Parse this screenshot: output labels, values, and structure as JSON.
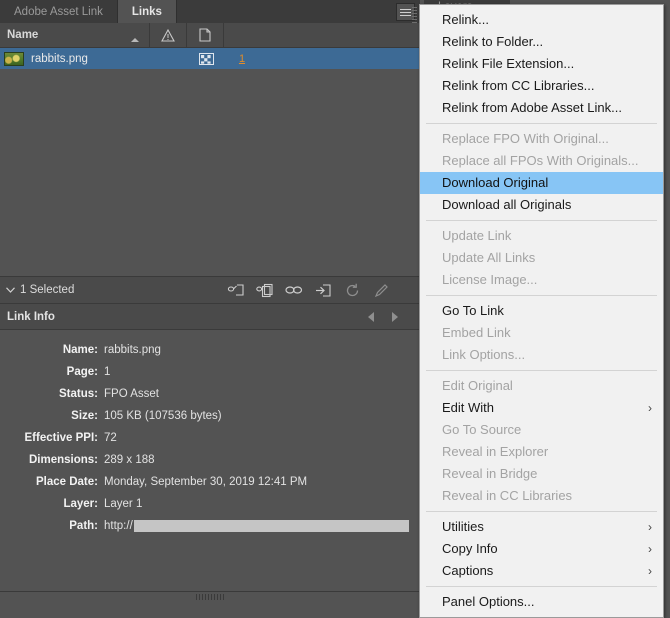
{
  "panel": {
    "tabs": [
      {
        "label": "Adobe Asset Link",
        "active": false
      },
      {
        "label": "Links",
        "active": true
      }
    ],
    "panel_menu_icon": "hamburger-menu-icon",
    "columns": {
      "name": "Name",
      "sort_icon": "sort-ascending-icon",
      "status_icon": "warning-triangle-icon",
      "page_icon": "page-icon"
    },
    "rows": [
      {
        "thumbnail": "image-thumbnail",
        "name": "rabbits.png",
        "status_icon": "fpo-asset-icon",
        "page": "1"
      }
    ],
    "selection_bar": {
      "disclosure_icon": "chevron-down-icon",
      "label": "1 Selected",
      "tools": [
        "relink-icon",
        "relink-from-library-icon",
        "go-to-link-icon",
        "update-link-icon",
        "refresh-icon",
        "edit-original-icon"
      ]
    },
    "link_info": {
      "title": "Link Info",
      "prev_icon": "previous-arrow-icon",
      "next_icon": "next-arrow-icon",
      "fields": [
        {
          "label": "Name:",
          "value": "rabbits.png"
        },
        {
          "label": "Page:",
          "value": "1"
        },
        {
          "label": "Status:",
          "value": "FPO Asset"
        },
        {
          "label": "Size:",
          "value": "105 KB (107536 bytes)"
        },
        {
          "label": "Effective PPI:",
          "value": "72"
        },
        {
          "label": "Dimensions:",
          "value": "289 x 188"
        },
        {
          "label": "Place Date:",
          "value": "Monday, September 30, 2019  12:41 PM"
        },
        {
          "label": "Layer:",
          "value": "Layer 1"
        },
        {
          "label": "Path:",
          "value": "http://"
        }
      ]
    },
    "resize_grip_icon": "resize-grip-icon"
  },
  "background_tab": {
    "label": "Layers"
  },
  "context_menu": {
    "items": [
      {
        "label": "Relink...",
        "state": "enabled",
        "submenu": false
      },
      {
        "label": "Relink to Folder...",
        "state": "enabled",
        "submenu": false
      },
      {
        "label": "Relink File Extension...",
        "state": "enabled",
        "submenu": false
      },
      {
        "label": "Relink from CC Libraries...",
        "state": "enabled",
        "submenu": false
      },
      {
        "label": "Relink from Adobe Asset Link...",
        "state": "enabled",
        "submenu": false
      },
      {
        "separator": true
      },
      {
        "label": "Replace FPO With Original...",
        "state": "disabled",
        "submenu": false
      },
      {
        "label": "Replace all FPOs With Originals...",
        "state": "disabled",
        "submenu": false
      },
      {
        "label": "Download Original",
        "state": "highlighted",
        "submenu": false
      },
      {
        "label": "Download all Originals",
        "state": "enabled",
        "submenu": false
      },
      {
        "separator": true
      },
      {
        "label": "Update Link",
        "state": "disabled",
        "submenu": false
      },
      {
        "label": "Update All Links",
        "state": "disabled",
        "submenu": false
      },
      {
        "label": "License Image...",
        "state": "disabled",
        "submenu": false
      },
      {
        "separator": true
      },
      {
        "label": "Go To Link",
        "state": "enabled",
        "submenu": false
      },
      {
        "label": "Embed Link",
        "state": "disabled",
        "submenu": false
      },
      {
        "label": "Link Options...",
        "state": "disabled",
        "submenu": false
      },
      {
        "separator": true
      },
      {
        "label": "Edit Original",
        "state": "disabled",
        "submenu": false
      },
      {
        "label": "Edit With",
        "state": "enabled",
        "submenu": true
      },
      {
        "label": "Go To Source",
        "state": "disabled",
        "submenu": false
      },
      {
        "label": "Reveal in Explorer",
        "state": "disabled",
        "submenu": false
      },
      {
        "label": "Reveal in Bridge",
        "state": "disabled",
        "submenu": false
      },
      {
        "label": "Reveal in CC Libraries",
        "state": "disabled",
        "submenu": false
      },
      {
        "separator": true
      },
      {
        "label": "Utilities",
        "state": "enabled",
        "submenu": true
      },
      {
        "label": "Copy Info",
        "state": "enabled",
        "submenu": true
      },
      {
        "label": "Captions",
        "state": "enabled",
        "submenu": true
      },
      {
        "separator": true
      },
      {
        "label": "Panel Options...",
        "state": "enabled",
        "submenu": false
      }
    ],
    "submenu_arrow": "chevron-right-icon"
  },
  "colors": {
    "panel_bg": "#535353",
    "header_bg": "#4a4a4a",
    "tabbar_bg": "#3b3b3b",
    "row_selected": "#3d6a95",
    "menu_bg": "#f1f1f1",
    "menu_highlight": "#87c5f5",
    "page_link": "#e08c2a"
  }
}
